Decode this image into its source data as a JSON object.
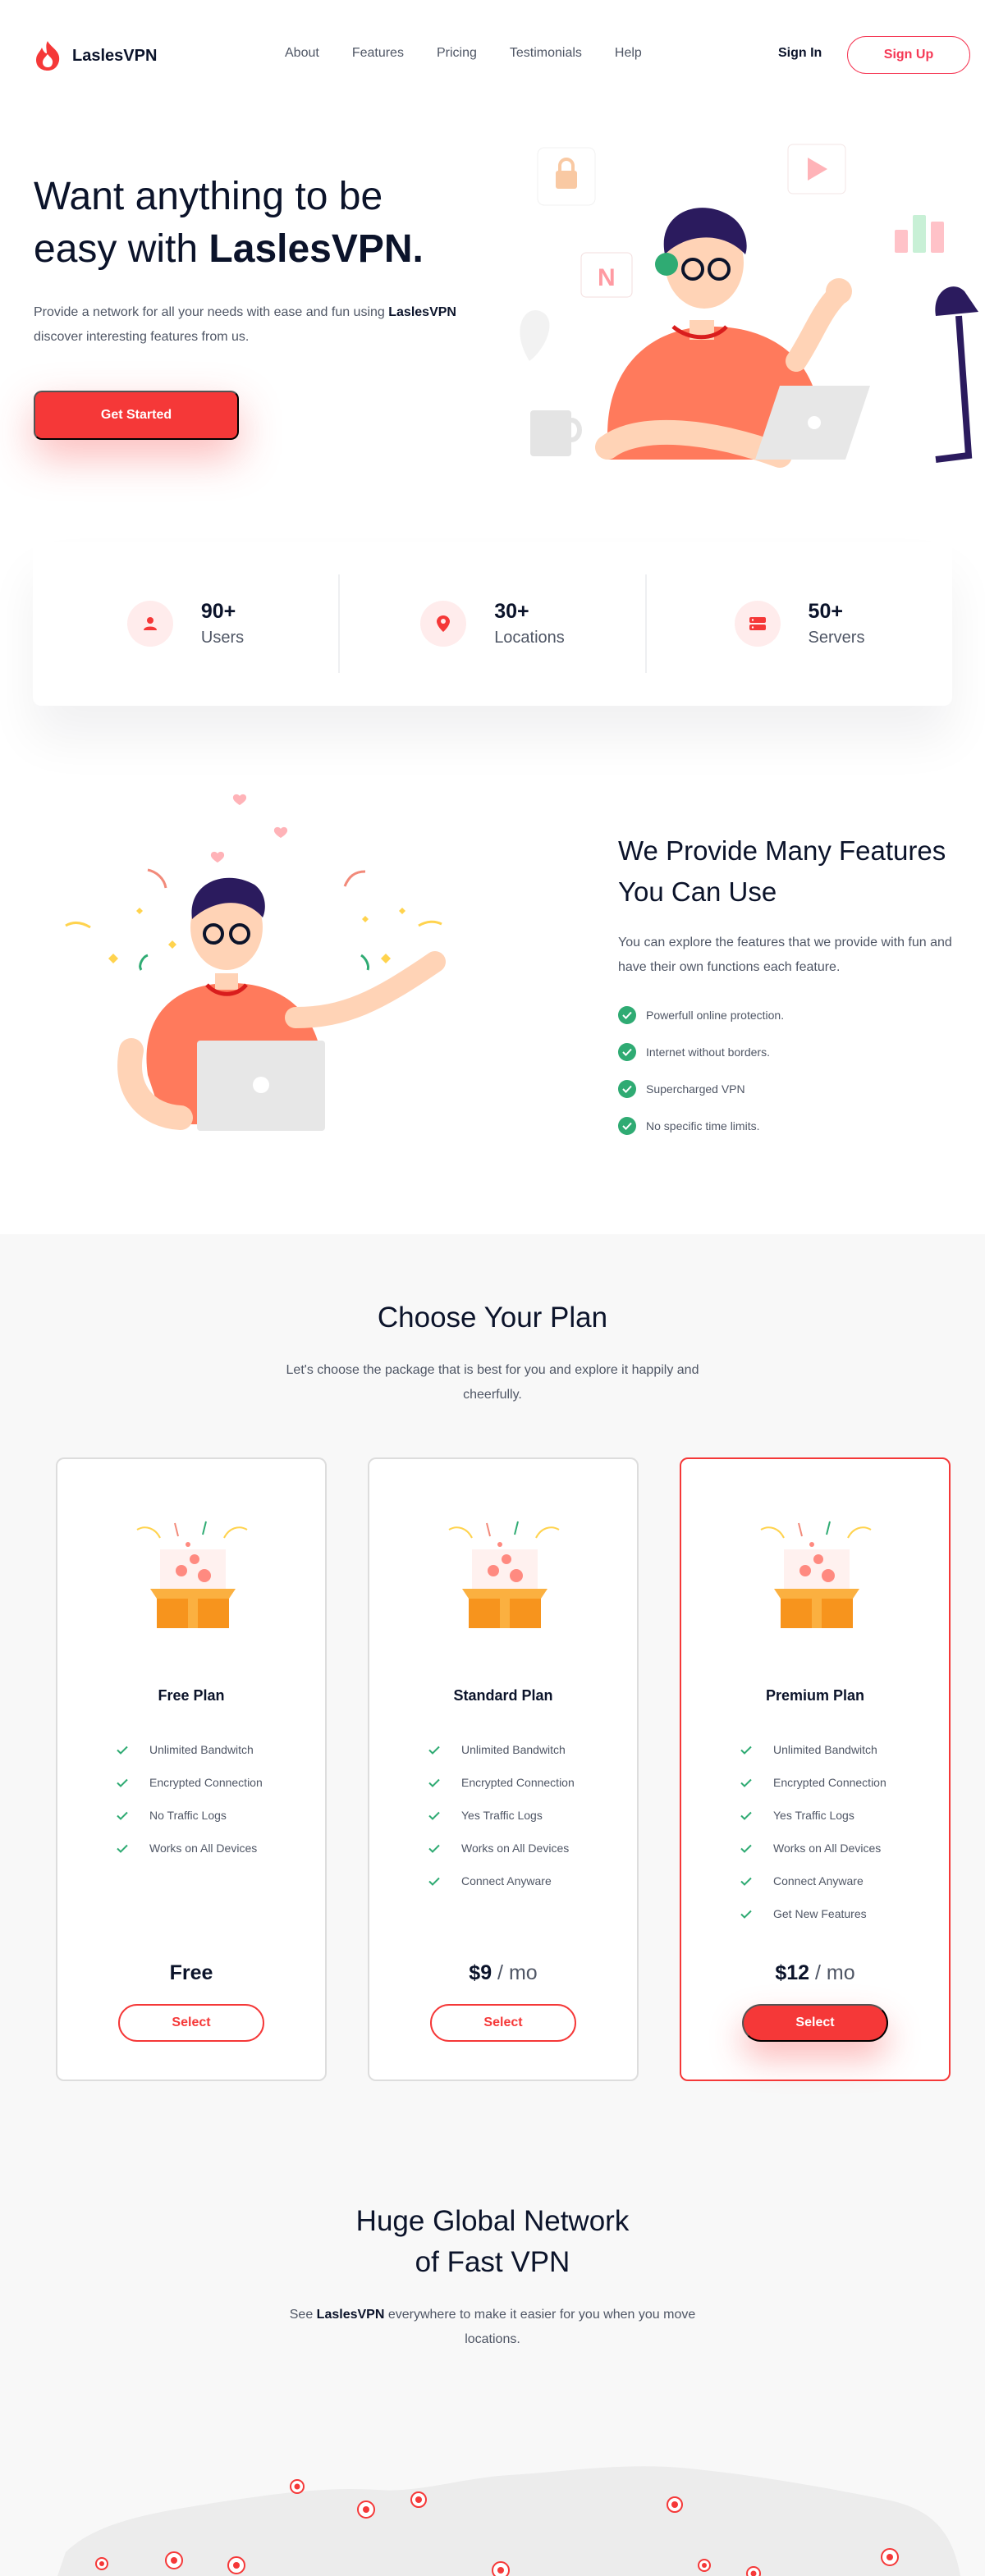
{
  "brand": {
    "name": "LaslesVPN",
    "accent": "#f53838"
  },
  "nav": {
    "links": [
      "About",
      "Features",
      "Pricing",
      "Testimonials",
      "Help"
    ],
    "signin": "Sign In",
    "signup": "Sign Up"
  },
  "hero": {
    "title_line1": "Want anything to be",
    "title_line2_prefix": "easy with ",
    "title_brand": "LaslesVPN.",
    "sub_prefix": "Provide a network for all your needs with ease and fun using ",
    "sub_brand": "LaslesVPN",
    "sub_suffix": " discover interesting features from us.",
    "cta": "Get Started"
  },
  "stats": [
    {
      "value": "90+",
      "label": "Users",
      "icon": "user-icon"
    },
    {
      "value": "30+",
      "label": "Locations",
      "icon": "location-pin-icon"
    },
    {
      "value": "50+",
      "label": "Servers",
      "icon": "server-icon"
    }
  ],
  "features": {
    "title": "We Provide Many Features You Can Use",
    "sub": "You can explore the features that we provide with fun and have their own functions each feature.",
    "items": [
      "Powerfull online protection.",
      "Internet without borders.",
      "Supercharged VPN",
      "No specific time limits."
    ]
  },
  "plans": {
    "title": "Choose Your Plan",
    "sub": "Let's choose the package that is best for you and explore it happily and cheerfully.",
    "cards": [
      {
        "name": "Free Plan",
        "features": [
          "Unlimited Bandwitch",
          "Encrypted Connection",
          "No Traffic Logs",
          "Works on All Devices"
        ],
        "price": "Free",
        "per": "",
        "select": "Select"
      },
      {
        "name": "Standard Plan",
        "features": [
          "Unlimited Bandwitch",
          "Encrypted Connection",
          "Yes Traffic Logs",
          "Works on All Devices",
          "Connect Anyware"
        ],
        "price": "$9",
        "per": " / mo",
        "select": "Select"
      },
      {
        "name": "Premium Plan",
        "features": [
          "Unlimited Bandwitch",
          "Encrypted Connection",
          "Yes Traffic Logs",
          "Works on All Devices",
          "Connect Anyware",
          "Get New Features"
        ],
        "price": "$12",
        "per": " / mo",
        "select": "Select"
      }
    ]
  },
  "network": {
    "title_line1": "Huge Global Network",
    "title_line2": "of Fast VPN",
    "sub_prefix": "See ",
    "sub_brand": "LaslesVPN",
    "sub_suffix": " everywhere to make it easier for you when you move locations."
  }
}
